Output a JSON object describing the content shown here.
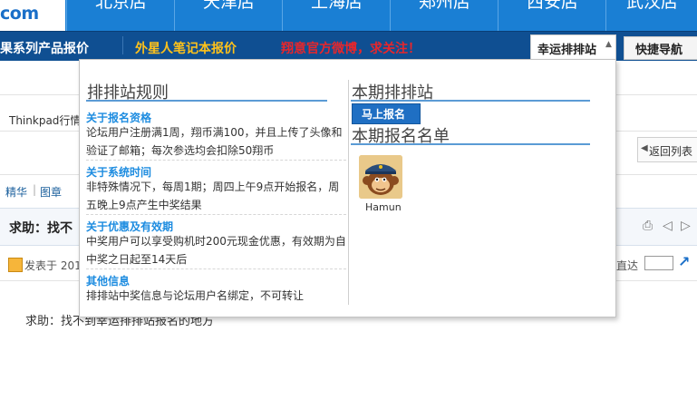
{
  "header": {
    "logo_text": "com",
    "cities": [
      "北京店",
      "天津店",
      "上海店",
      "郑州店",
      "西安店",
      "武汉店"
    ]
  },
  "nav": {
    "item1": "果系列产品报价",
    "item2": "外星人笔记本报价",
    "item3": "翔意官方微博，求关注！",
    "lucky_tab": "幸运排排站",
    "quick_tab": "快捷导航"
  },
  "page": {
    "thread_title": "Thinkpad行情",
    "back_label": "返回列表",
    "tags": [
      "精华",
      "图章"
    ],
    "post_title": "求助：找不",
    "posted_label": "发表于 201",
    "goto_label": "直达",
    "post_body": "求助：找不到幸运排排站报名的地方"
  },
  "dropdown": {
    "rules_title": "排排站规则",
    "rules": [
      {
        "title": "关于报名资格",
        "text": "论坛用户注册满1周，翔币满100，并且上传了头像和验证了邮箱；每次参选均会扣除50翔币"
      },
      {
        "title": "关于系统时间",
        "text": "非特殊情况下，每周1期；周四上午9点开始报名，周五晚上9点产生中奖结果"
      },
      {
        "title": "关于优惠及有效期",
        "text": "中奖用户可以享受购机时200元现金优惠，有效期为自中奖之日起至14天后"
      },
      {
        "title": "其他信息",
        "text": "排排站中奖信息与论坛用户名绑定，不可转让"
      }
    ],
    "current_title": "本期排排站",
    "signup_button": "马上报名",
    "list_title": "本期报名名单",
    "members": [
      {
        "name": "Hamun"
      }
    ]
  },
  "colors": {
    "topbar": "#1a7fd4",
    "navbar": "#0f4f92",
    "nav_link_yellow": "#ffc21a",
    "nav_link_red": "#e8262b",
    "accent_blue": "#1d8ce0"
  }
}
